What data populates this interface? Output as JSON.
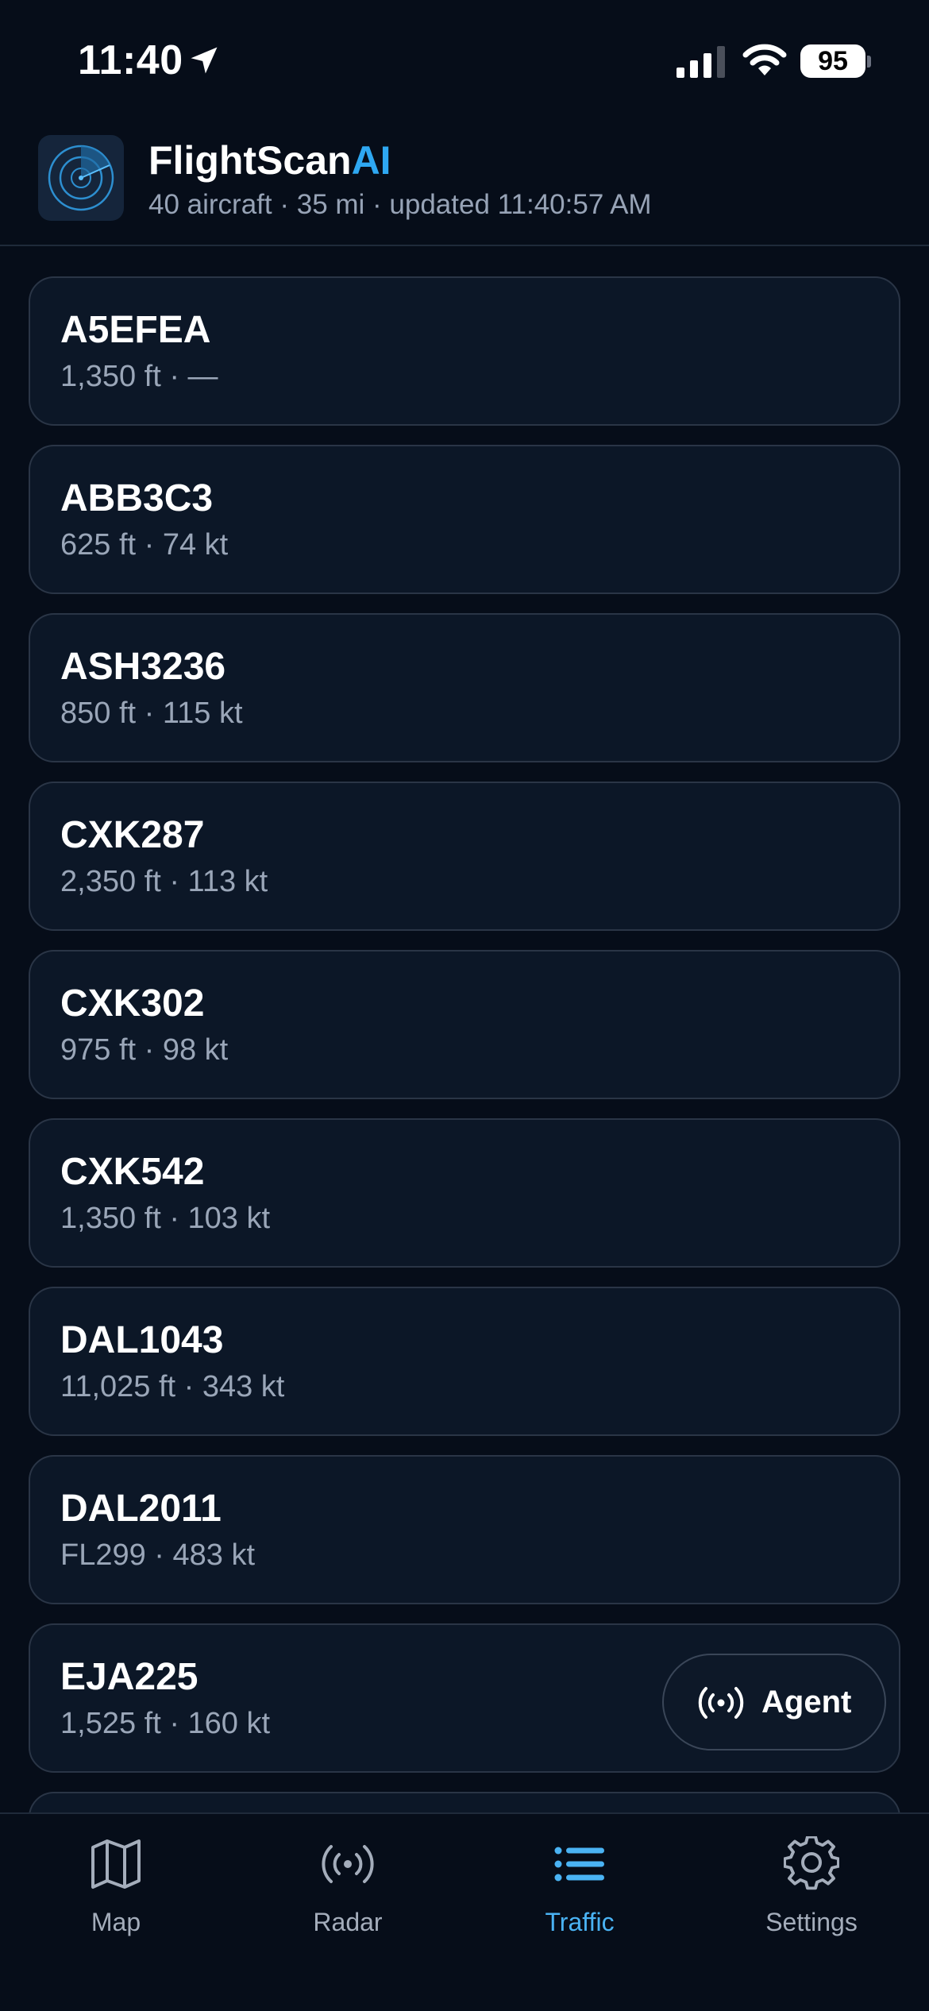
{
  "status_bar": {
    "time": "11:40",
    "battery": "95"
  },
  "header": {
    "title_main": "FlightScan",
    "title_accent": "AI",
    "subtitle": "40 aircraft · 35 mi · updated 11:40:57 AM"
  },
  "aircraft": [
    {
      "callsign": "A5EFEA",
      "details": "1,350 ft · —"
    },
    {
      "callsign": "ABB3C3",
      "details": "625 ft · 74 kt"
    },
    {
      "callsign": "ASH3236",
      "details": "850 ft · 115 kt"
    },
    {
      "callsign": "CXK287",
      "details": "2,350 ft · 113 kt"
    },
    {
      "callsign": "CXK302",
      "details": "975 ft · 98 kt"
    },
    {
      "callsign": "CXK542",
      "details": "1,350 ft · 103 kt"
    },
    {
      "callsign": "DAL1043",
      "details": "11,025 ft · 343 kt"
    },
    {
      "callsign": "DAL2011",
      "details": "FL299 · 483 kt"
    },
    {
      "callsign": "EJA225",
      "details": "1,525 ft · 160 kt"
    },
    {
      "callsign": "",
      "details": ""
    }
  ],
  "agent_button": {
    "label": "Agent",
    "icon": "broadcast-icon"
  },
  "tabs": [
    {
      "label": "Map",
      "icon": "map-icon",
      "active": false
    },
    {
      "label": "Radar",
      "icon": "radar-icon",
      "active": false
    },
    {
      "label": "Traffic",
      "icon": "list-icon",
      "active": true
    },
    {
      "label": "Settings",
      "icon": "gear-icon",
      "active": false
    }
  ],
  "colors": {
    "background": "#060d19",
    "card": "#0c1727",
    "accent": "#2ea8f2",
    "active_tab": "#4ab3f4",
    "muted_text": "#9aa6b8"
  }
}
